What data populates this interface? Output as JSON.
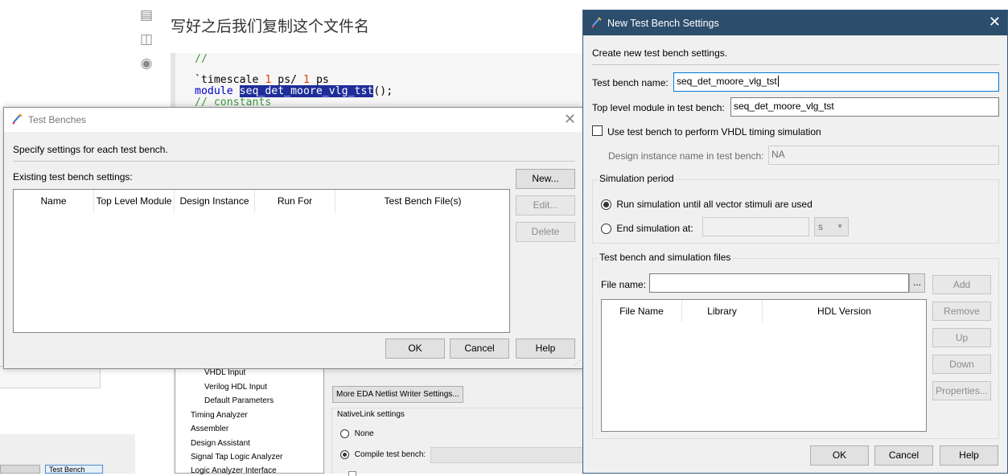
{
  "background": {
    "doc_title": "写好之后我们复制这个文件名",
    "code": {
      "comment_line": "//",
      "timescale_keyword": "`timescale",
      "timescale_num1": "1",
      "timescale_unit1": "ps/",
      "timescale_num2": "1",
      "timescale_unit2": "ps",
      "module_keyword": "module",
      "module_name": "seq_det_moore_vlg_tst",
      "module_tail": "();",
      "comment_constants": "// constants"
    },
    "tree_items": [
      "VHDL Input",
      "Verilog HDL Input",
      "Default Parameters",
      "Timing Analyzer",
      "Assembler",
      "Design Assistant",
      "Signal Tap Logic Analyzer",
      "Logic Analyzer Interface"
    ],
    "more_eda_button": "More EDA Netlist Writer Settings...",
    "nativelink_label": "NativeLink settings",
    "radio_none": "None",
    "radio_compile": "Compile test bench:",
    "taskbar_tab": "Test Bench"
  },
  "test_benches_dialog": {
    "title": "Test Benches",
    "description": "Specify settings for each test bench.",
    "existing_label": "Existing test bench settings:",
    "columns": [
      "Name",
      "Top Level Module",
      "Design Instance",
      "Run For",
      "Test Bench File(s)"
    ],
    "buttons": {
      "new": "New...",
      "edit": "Edit...",
      "delete": "Delete",
      "ok": "OK",
      "cancel": "Cancel",
      "help": "Help"
    }
  },
  "new_test_bench_dialog": {
    "title": "New Test Bench Settings",
    "description": "Create new test bench settings.",
    "tb_name_label": "Test bench name:",
    "tb_name_value": "seq_det_moore_vlg_tst",
    "top_level_label": "Top level module in test bench:",
    "top_level_value": "seq_det_moore_vlg_tst",
    "vhdl_timing_label": "Use test bench to perform VHDL timing simulation",
    "vhdl_timing_checked": false,
    "design_instance_label": "Design instance name in test bench:",
    "design_instance_value": "NA",
    "sim_period": {
      "group_label": "Simulation period",
      "run_until_label": "Run simulation until all vector stimuli are used",
      "end_at_label": "End simulation at:",
      "end_at_value": "",
      "unit_value": "s",
      "selected": "run_until"
    },
    "files": {
      "group_label": "Test bench and simulation files",
      "file_name_label": "File name:",
      "file_name_value": "",
      "browse_label": "...",
      "columns": [
        "File Name",
        "Library",
        "HDL Version"
      ],
      "buttons": {
        "add": "Add",
        "remove": "Remove",
        "up": "Up",
        "down": "Down",
        "properties": "Properties..."
      }
    },
    "buttons": {
      "ok": "OK",
      "cancel": "Cancel",
      "help": "Help"
    }
  }
}
